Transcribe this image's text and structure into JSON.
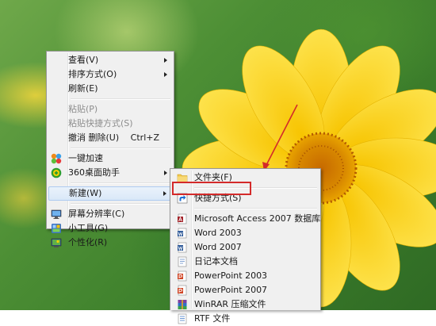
{
  "main_menu": {
    "items": [
      {
        "label": "查看(V)",
        "arrow": true
      },
      {
        "label": "排序方式(O)",
        "arrow": true
      },
      {
        "label": "刷新(E)"
      },
      {
        "label": "粘贴(P)",
        "disabled": true
      },
      {
        "label": "粘贴快捷方式(S)",
        "disabled": true
      },
      {
        "label": "撤消 删除(U)",
        "shortcut": "Ctrl+Z"
      },
      {
        "label": "一键加速",
        "icon": "speedup-icon"
      },
      {
        "label": "360桌面助手",
        "icon": "desktop-helper-icon",
        "arrow": true
      },
      {
        "label": "新建(W)",
        "arrow": true,
        "highlighted": true
      },
      {
        "label": "屏幕分辨率(C)",
        "icon": "monitor-icon"
      },
      {
        "label": "小工具(G)",
        "icon": "gadgets-icon"
      },
      {
        "label": "个性化(R)",
        "icon": "personalize-icon"
      }
    ]
  },
  "new_submenu": {
    "items": [
      {
        "label": "文件夹(F)",
        "icon": "folder-icon"
      },
      {
        "label": "快捷方式(S)",
        "icon": "shortcut-icon",
        "boxed": true
      },
      {
        "label": "Microsoft Access 2007 数据库",
        "icon": "access-icon"
      },
      {
        "label": "Word 2003",
        "icon": "word-icon"
      },
      {
        "label": "Word 2007",
        "icon": "word-icon"
      },
      {
        "label": "日记本文档",
        "icon": "journal-icon"
      },
      {
        "label": "PowerPoint 2003",
        "icon": "powerpoint-icon"
      },
      {
        "label": "PowerPoint 2007",
        "icon": "powerpoint-icon"
      },
      {
        "label": "WinRAR 压缩文件",
        "icon": "winrar-icon"
      },
      {
        "label": "RTF 文件",
        "icon": "rtf-icon"
      }
    ]
  },
  "colors": {
    "annotation_red": "#d42a2a",
    "menu_bg": "#f0f0f0",
    "flower_yellow": "#f5d21a"
  }
}
